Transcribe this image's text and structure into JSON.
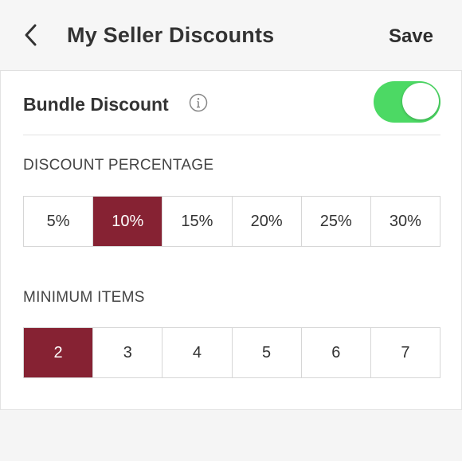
{
  "header": {
    "title": "My Seller Discounts",
    "save_label": "Save"
  },
  "bundle": {
    "label": "Bundle Discount",
    "enabled": true
  },
  "discount": {
    "label": "DISCOUNT PERCENTAGE",
    "options": [
      "5%",
      "10%",
      "15%",
      "20%",
      "25%",
      "30%"
    ],
    "selected": "10%"
  },
  "minimum": {
    "label": "MINIMUM ITEMS",
    "options": [
      "2",
      "3",
      "4",
      "5",
      "6",
      "7"
    ],
    "selected": "2"
  },
  "colors": {
    "accent": "#862233",
    "toggle_on": "#4cd964"
  }
}
